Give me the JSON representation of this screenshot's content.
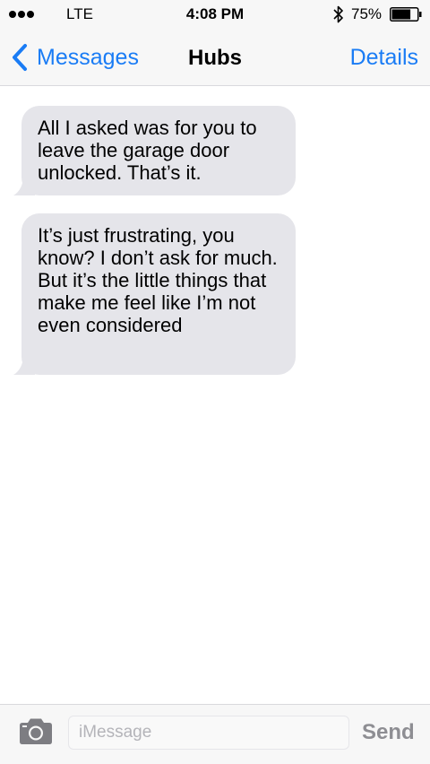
{
  "status_bar": {
    "carrier": "LTE",
    "time": "4:08 PM",
    "battery": "75%",
    "battery_level": 0.75,
    "icons": [
      "signal-dots-icon",
      "bluetooth-icon",
      "battery-icon"
    ]
  },
  "nav": {
    "back_label": "Messages",
    "title": "Hubs",
    "details_label": "Details"
  },
  "messages": [
    {
      "text": "All I asked was for you to leave the garage door unlocked. That’s it."
    },
    {
      "text": "It’s just frustrating, you know? I don’t ask for much. But it’s the little things that make me feel like I’m not even considered"
    }
  ],
  "input": {
    "placeholder": "iMessage",
    "value": "",
    "send_label": "Send"
  },
  "colors": {
    "accent": "#1a7cf5",
    "incoming_bubble": "#e5e5ea",
    "bar_background": "#f7f7f7",
    "send_disabled": "#8e8e93"
  }
}
